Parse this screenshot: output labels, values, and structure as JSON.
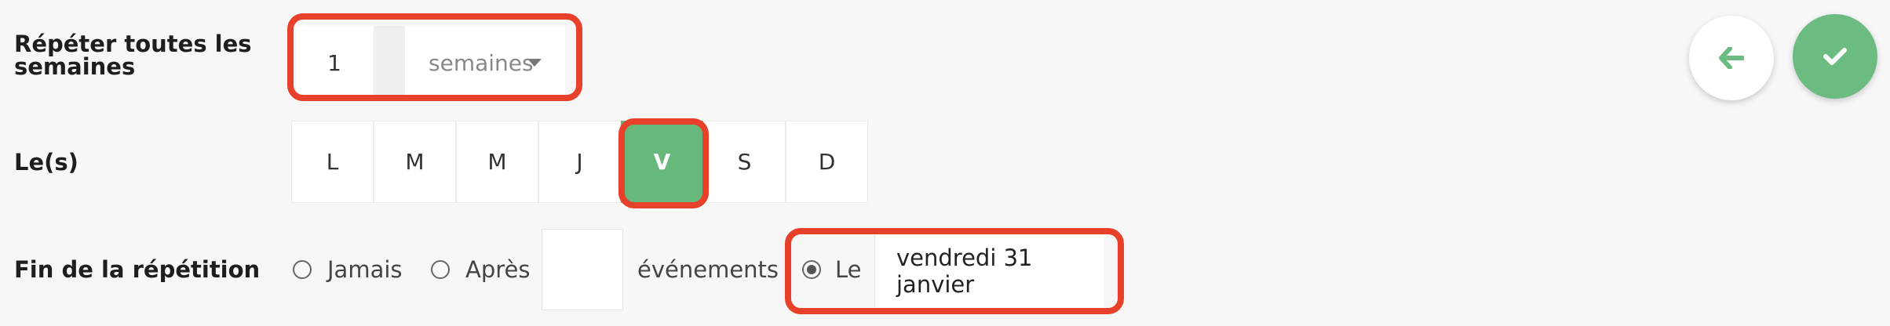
{
  "repeat": {
    "label": "Répéter toutes les semaines",
    "interval_value": "1",
    "unit_selected": "semaines"
  },
  "days": {
    "label": "Le(s)",
    "items": [
      {
        "letter": "L",
        "selected": false
      },
      {
        "letter": "M",
        "selected": false
      },
      {
        "letter": "M",
        "selected": false
      },
      {
        "letter": "J",
        "selected": false
      },
      {
        "letter": "V",
        "selected": true
      },
      {
        "letter": "S",
        "selected": false
      },
      {
        "letter": "D",
        "selected": false
      }
    ]
  },
  "end": {
    "label": "Fin de la répétition",
    "never_label": "Jamais",
    "after_label": "Après",
    "after_value": "",
    "events_label": "événements",
    "on_label": "Le",
    "date_value": "vendredi 31 janvier",
    "selected_option": "Le"
  },
  "actions": {
    "back_icon": "arrow-left-icon",
    "confirm_icon": "check-icon"
  },
  "colors": {
    "accent_green": "#67b97b",
    "highlight_red": "#e8402a",
    "background": "#f7f7f7"
  }
}
